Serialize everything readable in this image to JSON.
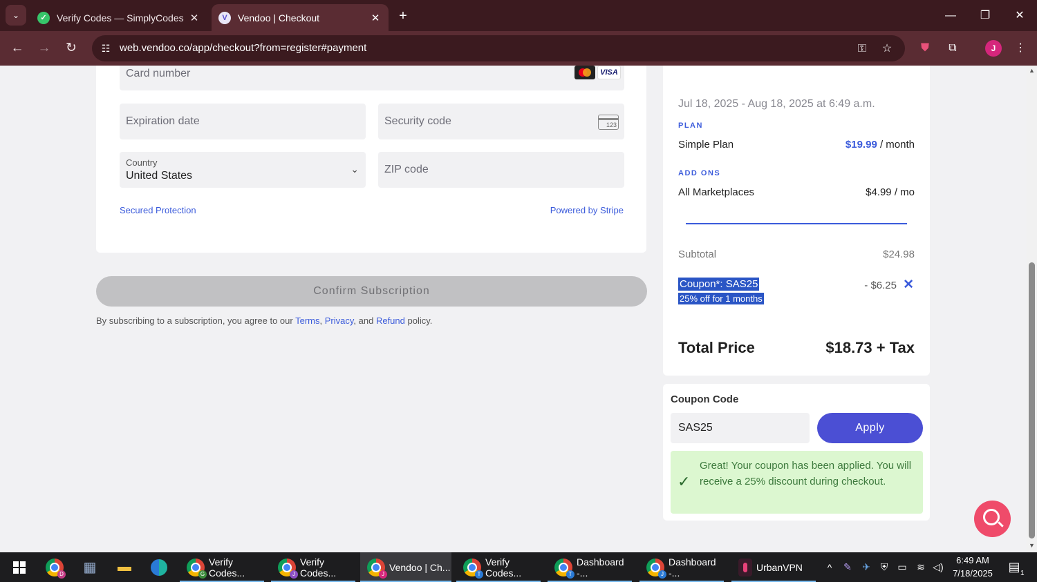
{
  "browser": {
    "tabs": [
      {
        "title": "Verify Codes — SimplyCodes",
        "active": false
      },
      {
        "title": "Vendoo | Checkout",
        "active": true
      }
    ],
    "url": "web.vendoo.co/app/checkout?from=register#payment",
    "profile_initial": "J"
  },
  "payment_form": {
    "card_number_placeholder": "Card number",
    "card_brands": [
      "mastercard",
      "VISA"
    ],
    "expiration_placeholder": "Expiration date",
    "security_code_placeholder": "Security code",
    "cvc_icon_text": "123",
    "country_label": "Country",
    "country_value": "United States",
    "zip_placeholder": "ZIP code",
    "secured_link": "Secured Protection",
    "powered_link": "Powered by Stripe"
  },
  "confirm": {
    "button_label": "Confirm Subscription",
    "terms_prefix": "By subscribing to a subscription, you agree to our",
    "terms_link": "Terms",
    "sep1": ",",
    "privacy_link": "Privacy",
    "sep2": ", and",
    "refund_link": "Refund",
    "terms_suffix": "policy."
  },
  "summary": {
    "date_range": "Jul 18, 2025 - Aug 18, 2025 at 6:49 a.m.",
    "plan_heading": "PLAN",
    "plan_name": "Simple Plan",
    "plan_price": "$19.99",
    "plan_period": "/ month",
    "addons_heading": "ADD ONS",
    "addon_name": "All Marketplaces",
    "addon_price": "$4.99 / mo",
    "subtotal_label": "Subtotal",
    "subtotal_value": "$24.98",
    "coupon_name": "Coupon*: SAS25",
    "coupon_desc": "25% off for 1 months",
    "coupon_discount": "- $6.25",
    "total_label": "Total Price",
    "total_value": "$18.73 + Tax"
  },
  "coupon_box": {
    "title": "Coupon Code",
    "input_value": "SAS25",
    "apply_label": "Apply",
    "success_message": "Great! Your coupon has been applied. You will receive a 25% discount during checkout."
  },
  "taskbar": {
    "apps": [
      {
        "label": "Verify Codes...",
        "badge": "G"
      },
      {
        "label": "Verify Codes...",
        "badge": "J"
      },
      {
        "label": "Vendoo | Ch...",
        "badge": "J"
      },
      {
        "label": "Verify Codes...",
        "badge": "T"
      },
      {
        "label": "Dashboard -...",
        "badge": "T"
      },
      {
        "label": "Dashboard -...",
        "badge": "J"
      },
      {
        "label": "UrbanVPN",
        "badge": ""
      }
    ],
    "pinned_badge": "D",
    "time": "6:49 AM",
    "date": "7/18/2025",
    "notification_count": "1"
  },
  "colors": {
    "accent": "#3b5bdb",
    "apply_button": "#4b4fd4",
    "success_bg": "#dcf7d0",
    "browser_frame": "#3b1a1f"
  }
}
